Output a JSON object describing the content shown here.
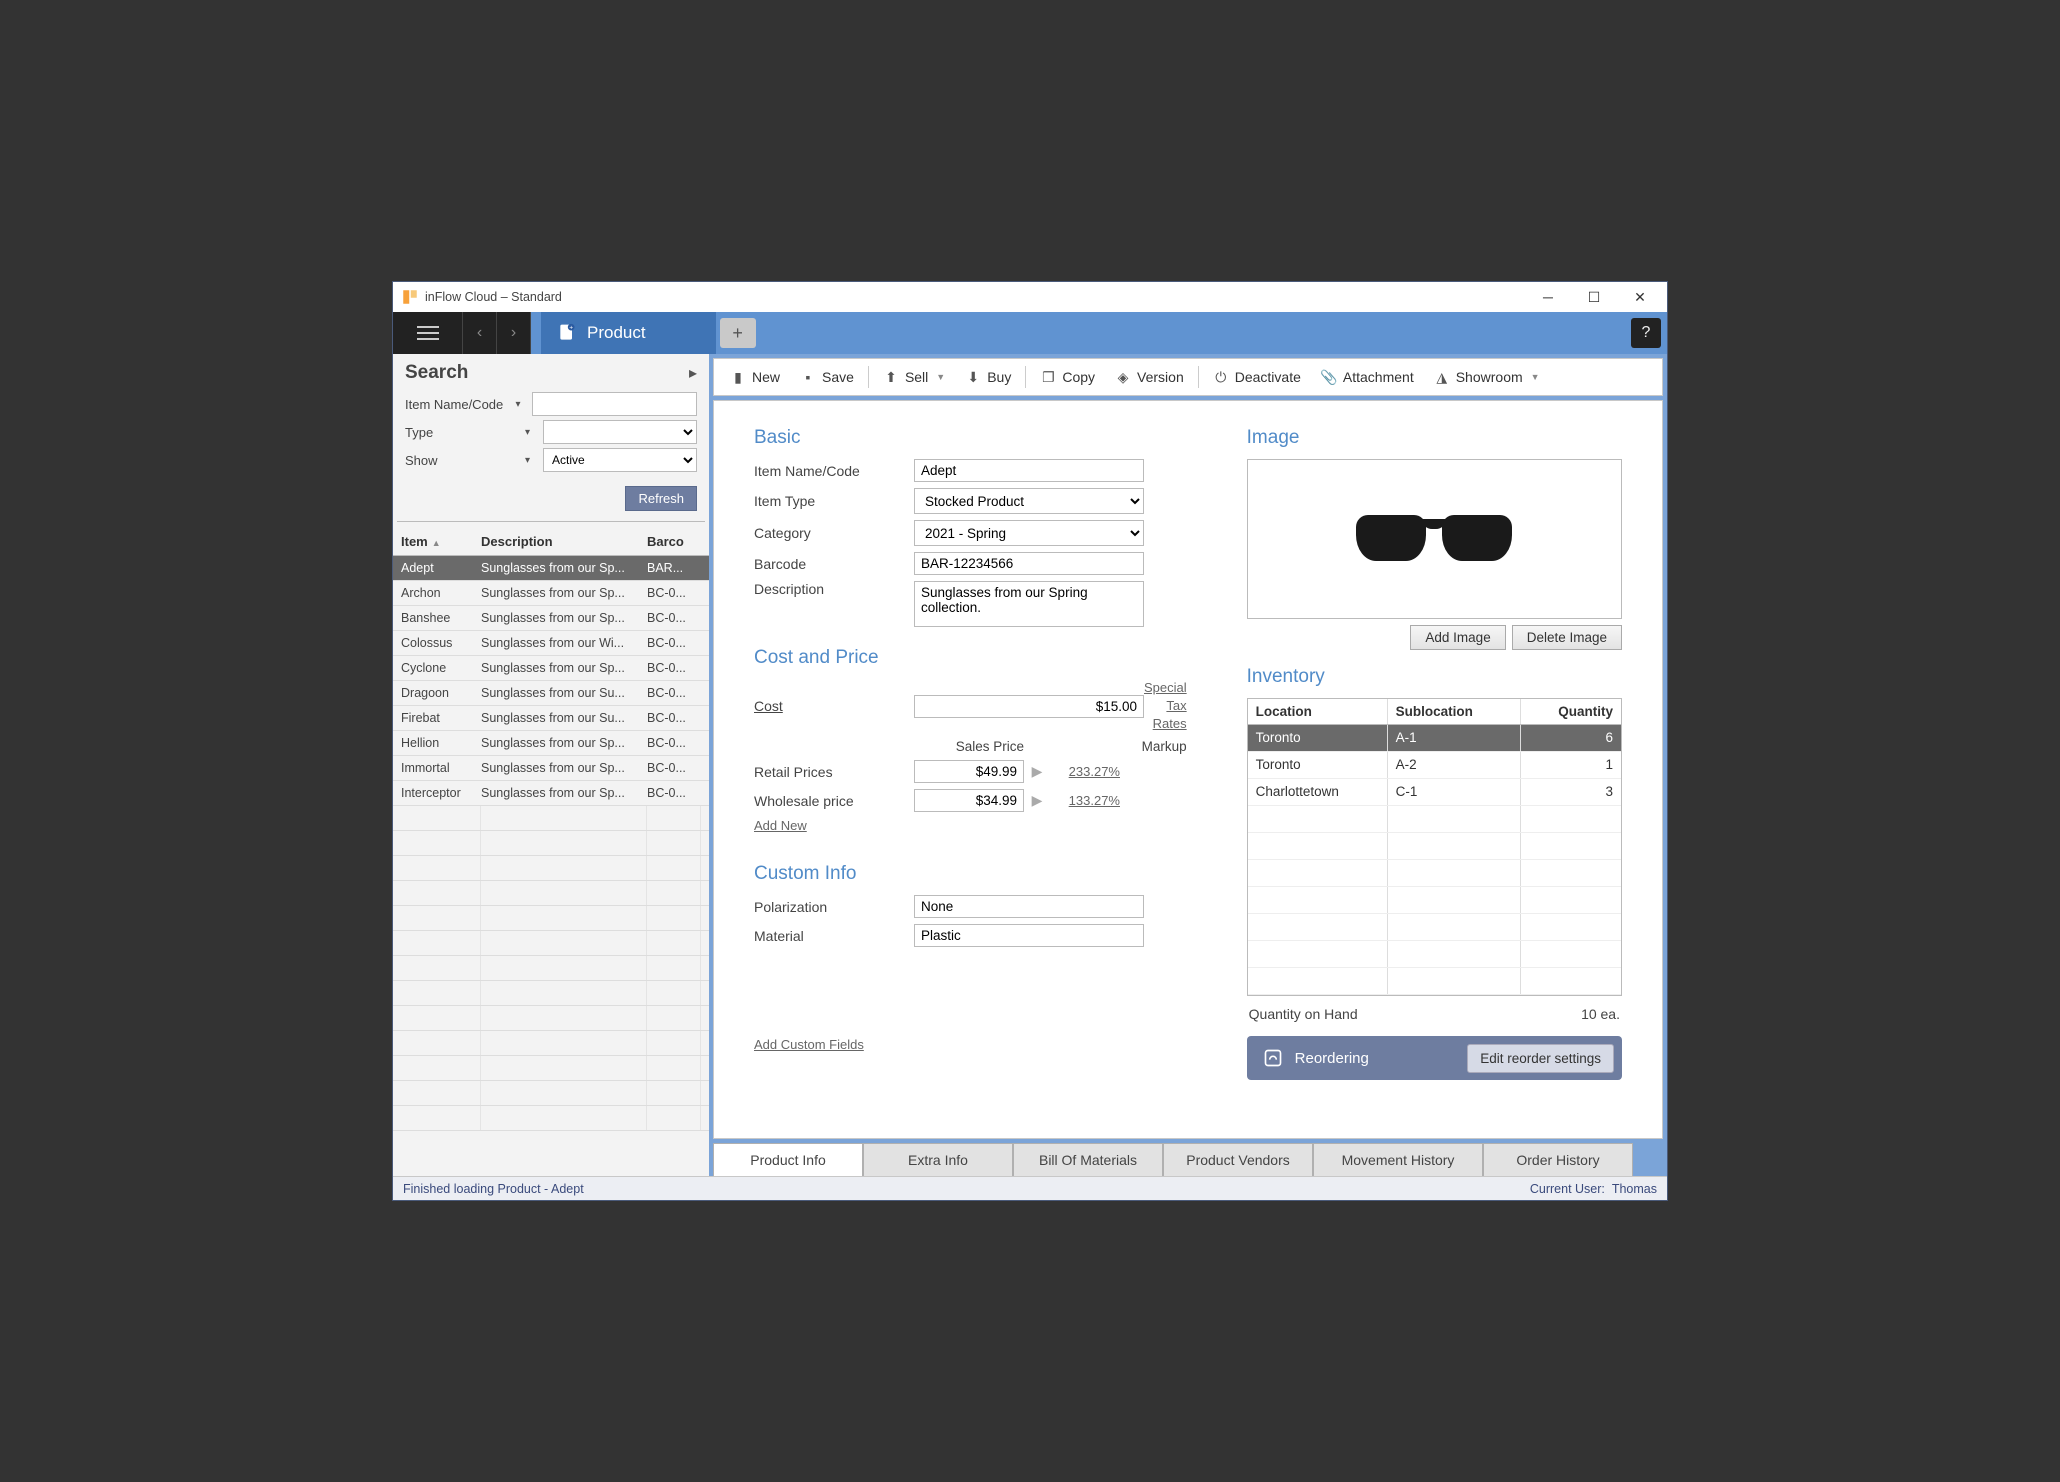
{
  "window": {
    "title": "inFlow Cloud – Standard"
  },
  "tab": {
    "label": "Product"
  },
  "search": {
    "heading": "Search",
    "filters": {
      "name_label": "Item Name/Code",
      "type_label": "Type",
      "show_label": "Show",
      "show_value": "Active"
    },
    "refresh_label": "Refresh",
    "columns": {
      "item": "Item",
      "description": "Description",
      "barcode": "Barco"
    },
    "rows": [
      {
        "item": "Adept",
        "description": "Sunglasses from our Sp...",
        "barcode": "BAR...",
        "selected": true
      },
      {
        "item": "Archon",
        "description": "Sunglasses from our Sp...",
        "barcode": "BC-0..."
      },
      {
        "item": "Banshee",
        "description": "Sunglasses from our Sp...",
        "barcode": "BC-0..."
      },
      {
        "item": "Colossus",
        "description": "Sunglasses from our Wi...",
        "barcode": "BC-0..."
      },
      {
        "item": "Cyclone",
        "description": "Sunglasses from our Sp...",
        "barcode": "BC-0..."
      },
      {
        "item": "Dragoon",
        "description": "Sunglasses from our Su...",
        "barcode": "BC-0..."
      },
      {
        "item": "Firebat",
        "description": "Sunglasses from our Su...",
        "barcode": "BC-0..."
      },
      {
        "item": "Hellion",
        "description": "Sunglasses from our Sp...",
        "barcode": "BC-0..."
      },
      {
        "item": "Immortal",
        "description": "Sunglasses from our Sp...",
        "barcode": "BC-0..."
      },
      {
        "item": "Interceptor",
        "description": "Sunglasses from our Sp...",
        "barcode": "BC-0..."
      }
    ]
  },
  "toolbar": {
    "new": "New",
    "save": "Save",
    "sell": "Sell",
    "buy": "Buy",
    "copy": "Copy",
    "version": "Version",
    "deactivate": "Deactivate",
    "attachment": "Attachment",
    "showroom": "Showroom"
  },
  "basic": {
    "heading": "Basic",
    "name_label": "Item Name/Code",
    "name_value": "Adept",
    "type_label": "Item Type",
    "type_value": "Stocked Product",
    "category_label": "Category",
    "category_value": "2021 - Spring",
    "barcode_label": "Barcode",
    "barcode_value": "BAR-12234566",
    "description_label": "Description",
    "description_value": "Sunglasses from our Spring collection."
  },
  "price": {
    "heading": "Cost and Price",
    "cost_label": "Cost",
    "cost_value": "$15.00",
    "special_tax": "Special Tax Rates",
    "sales_price_head": "Sales Price",
    "markup_head": "Markup",
    "retail_label": "Retail Prices",
    "retail_value": "$49.99",
    "retail_markup": "233.27%",
    "wholesale_label": "Wholesale price",
    "wholesale_value": "$34.99",
    "wholesale_markup": "133.27%",
    "add_new": "Add New"
  },
  "custom": {
    "heading": "Custom Info",
    "polarization_label": "Polarization",
    "polarization_value": "None",
    "material_label": "Material",
    "material_value": "Plastic",
    "add_custom": "Add Custom Fields"
  },
  "image": {
    "heading": "Image",
    "add_label": "Add Image",
    "delete_label": "Delete Image"
  },
  "inventory": {
    "heading": "Inventory",
    "columns": {
      "location": "Location",
      "sublocation": "Sublocation",
      "quantity": "Quantity"
    },
    "rows": [
      {
        "location": "Toronto",
        "sublocation": "A-1",
        "quantity": "6",
        "selected": true
      },
      {
        "location": "Toronto",
        "sublocation": "A-2",
        "quantity": "1"
      },
      {
        "location": "Charlottetown",
        "sublocation": "C-1",
        "quantity": "3"
      }
    ],
    "qoh_label": "Quantity on Hand",
    "qoh_value": "10 ea.",
    "reorder_label": "Reordering",
    "reorder_button": "Edit reorder settings"
  },
  "bottom_tabs": {
    "product_info": "Product Info",
    "extra_info": "Extra Info",
    "bom": "Bill Of Materials",
    "vendors": "Product Vendors",
    "movement": "Movement History",
    "orders": "Order History"
  },
  "status": {
    "left": "Finished loading Product - Adept",
    "user_label": "Current User:",
    "user_value": "Thomas"
  }
}
